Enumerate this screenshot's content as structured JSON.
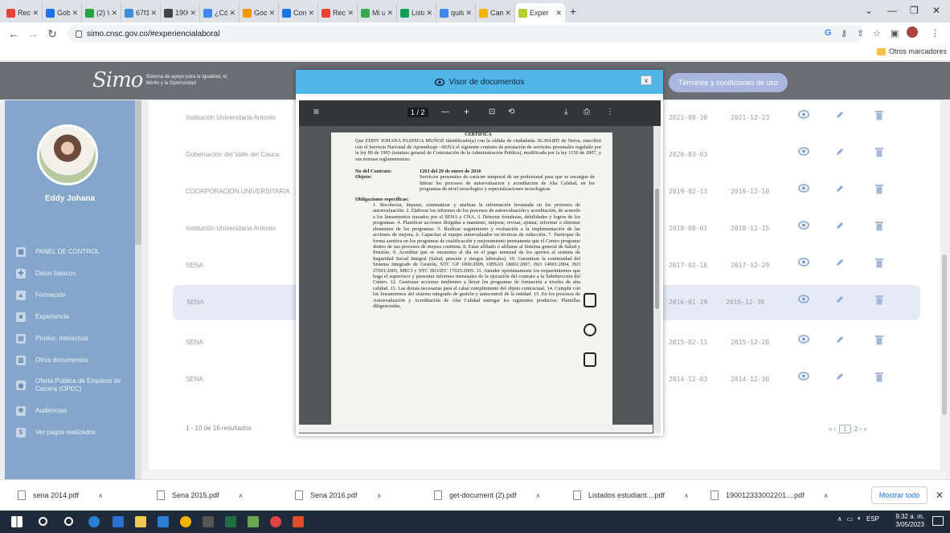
{
  "browser": {
    "tabs": [
      {
        "label": "Recib",
        "color": "#ea4335"
      },
      {
        "label": "Gobe",
        "color": "#1a73e8"
      },
      {
        "label": "(2) W",
        "color": "#25a244"
      },
      {
        "label": "67f1c",
        "color": "#3b8dd6"
      },
      {
        "label": "1900",
        "color": "#444444"
      },
      {
        "label": "¿Cón",
        "color": "#4285f4"
      },
      {
        "label": "Goog",
        "color": "#f29900"
      },
      {
        "label": "Corre",
        "color": "#1a73e8"
      },
      {
        "label": "Recib",
        "color": "#ea4335"
      },
      {
        "label": "Mi ur",
        "color": "#34a853"
      },
      {
        "label": "Listas",
        "color": "#0f9d58"
      },
      {
        "label": "quita",
        "color": "#4285f4"
      },
      {
        "label": "Camb",
        "color": "#f4b400"
      }
    ],
    "active_tab": {
      "label": "Exper",
      "color": "#b5cc32"
    },
    "new_tab": "+",
    "url": "simo.cnsc.gov.co/#experiencialaboral",
    "bookmarks_other": "Otros marcadores"
  },
  "site": {
    "logo_mark": "Simo",
    "logo_tagline": "Sistema de apoyo para la Igualdad, el Mérito y la Oportunidad",
    "terms_button": "Términos y condiciones de uso",
    "user_name": "Eddy Johana",
    "menu": [
      {
        "label": "PANEL DE CONTROL",
        "icon": "▦"
      },
      {
        "label": "Datos básicos",
        "icon": "✚"
      },
      {
        "label": "Formación",
        "icon": "▲"
      },
      {
        "label": "Experiencia",
        "icon": "■"
      },
      {
        "label": "Produc. intelectual",
        "icon": "▤"
      },
      {
        "label": "Otros documentos",
        "icon": "▥"
      },
      {
        "label": "Oferta Pública de Empleos de Carrera (OPEC)",
        "icon": "◉"
      },
      {
        "label": "Audiencias",
        "icon": "✱"
      },
      {
        "label": "Ver pagos realizados",
        "icon": "$"
      }
    ],
    "rows": [
      {
        "institution": "Institución Universitaria Antonio",
        "start": "2021-08-30",
        "end": "2021-12-23"
      },
      {
        "institution": "Gobernación del Valle del Cauca",
        "start": "2020-03-03",
        "end": ""
      },
      {
        "institution": "COORPORACIÓN UNIVERSITARIA",
        "start": "2019-02-13",
        "end": "2019-12-10"
      },
      {
        "institution": "Institución Universitaria Antonio",
        "start": "2018-08-01",
        "end": "2018-12-15"
      },
      {
        "institution": "SENA",
        "start": "2017-02-16",
        "end": "2017-12-29"
      },
      {
        "institution": "SENA",
        "start": "2016-01-29",
        "end": "2016-12-30"
      },
      {
        "institution": "SENA",
        "start": "2015-02-11",
        "end": "2015-12-28"
      },
      {
        "institution": "SENA",
        "start": "2014-12-03",
        "end": "2014-12-30"
      }
    ],
    "results": "1 - 10 de 16 resultados",
    "pager": {
      "first": "«",
      "prev": "‹",
      "current": "1",
      "next_page": "2",
      "next": "›",
      "last": "»"
    }
  },
  "modal": {
    "title": "Visor de documentos",
    "close": "x",
    "pdf_page": "1 / 2",
    "doc": {
      "heading": "CERTIFICA",
      "intro": "Que EDDY JOHANA PASINGA MUÑOZ identificado(a) con la cédula de ciudadanía 36.304.805 de Neiva, suscribió con el Servicio Nacional de Aprendizaje –SENA el siguiente contrato de prestación de servicios personales regulado por la ley 80 de 1993 (estatuto general de Contratación de la Administración Publica), modificada por la ley 1150 de 2007, y sus normas reglamentarias:",
      "contract_label": "No del Contrato:",
      "contract_value": "1263 del 29 de enero de 2016",
      "object_label": "Objeto:",
      "object_value": "Servicios personales de carácter temporal de un profesional para que se encargue de liderar los procesos de autoevaluacion y acreditacion de Alta Calidad, en los programas de nivel tecnologico y especializaciones tecnologicas.",
      "obligations_label": "Obligaciones específicas:",
      "obligations": "1. Recolectar, depurar, sistematizar y analizar la información levantada en los procesos de autoevaluación. 2. Elaborar los informes de los procesos de autoevaluación y acreditación, de acuerdo a los lineamientos trazados por el SENA y CNA. 3. Detectar fortalezas, debilidades y logros de los programas. 4. Planificar acciones dirigidas a mantener, mejorar, revisar, ajustar, reformar o eliminar elementos de los programas. 5. Realizar seguimiento y evaluación a la implementación de las acciones de mejora. 6. Capacitar al equipo autoevaluador en técnicas de redacción. 7. Participar de forma asertiva en los programas de cualificación y mejoramiento permanente que el Centro programe dentro de sus procesos de mejora continua. 8. Estar afiliado o afiliarse al Sistema general de Salud y Pensión. 9. Acreditar que se encuentra al día en el pago mensual de los aportes al sistema de Seguridad Social Integral (Salud, pensión y riesgos laborales). 10. Garantizar la continuidad del Sistema Integrado de Gestión, NTC GP 1000:2009, OHSAS 18001:2007, ISO 14001:2004, ISO 27001:2005, MECI y NTC ISO/IEC 17025:2005. 11. Atender oportunamente los requerimientos que haga el supervisor y presentar informes mensuales de la ejecución del contrato a la Subdirección del Centro. 12. Gestionar acciones tendientes a llevar los programas de formación a niveles de alta calidad. 13. Las demás necesarias para el cabal cumplimiento del objeto contractual. 14. Cumplir con los lineamientos del sistema integrado de gestión y autocontrol de la entidad. 15. En los procesos de Autoevaluación y Acreditación de Alta Calidad entregar los siguientes productos: Plantillas diligenciadas,"
    }
  },
  "downloads": {
    "files": [
      "sena 2014.pdf",
      "Sena 2015.pdf",
      "Sena 2016.pdf",
      "get-document (2).pdf",
      "Listados estudiant....pdf",
      "190012333002201....pdf"
    ],
    "show_all": "Mostrar todo",
    "close": "✕"
  },
  "taskbar": {
    "lang": "ESP",
    "time": "9:32 a. m.",
    "date": "3/05/2023"
  }
}
